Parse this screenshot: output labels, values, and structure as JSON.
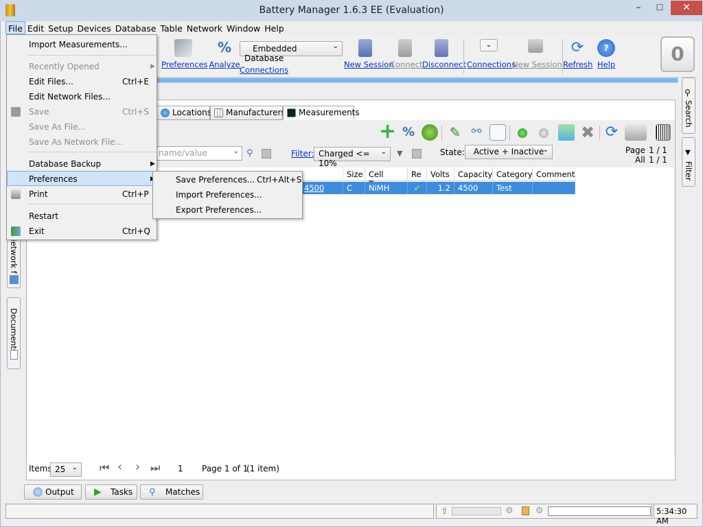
{
  "window": {
    "title": "Battery Manager 1.6.3 EE (Evaluation)",
    "minimize": "–",
    "maximize": "☐",
    "close": "✕"
  },
  "menubar": [
    "File",
    "Edit",
    "Setup",
    "Devices",
    "Database",
    "Table",
    "Network",
    "Window",
    "Help"
  ],
  "toolbar": {
    "preferences": "Preferences",
    "analyze": "Analyze",
    "connections": "Connections",
    "database_select": "Embedded Database",
    "new_session": "New Session",
    "connect": "Connect",
    "disconnect": "Disconnect",
    "connections2": "Connections",
    "new_session2": "New Session",
    "refresh": "Refresh",
    "help": "Help",
    "counter": "0"
  },
  "tabs": [
    "Locations",
    "Manufacturers",
    "Measurements"
  ],
  "filter": {
    "search_placeholder": "name/value",
    "label": "Filter:",
    "value": "Charged <= 10%",
    "state_label": "State:",
    "state_value": "Active + Inactive"
  },
  "paging": {
    "page_label": "Page",
    "page_value": "1 / 1",
    "all_label": "All",
    "all_value": "1 / 1"
  },
  "table": {
    "columns": [
      "Size",
      "Cell Type",
      "Re",
      "Volts",
      "Capacity",
      "Category",
      "Comment"
    ],
    "row": {
      "capacity_link": "4500 mAh",
      "size": "C",
      "cell_type": "NiMH",
      "re": "✔",
      "volts": "1.2 V",
      "capacity": "4500 mAh",
      "category": "Test",
      "comment": ""
    }
  },
  "footer": {
    "items_label": "Items",
    "items_value": "25",
    "page_num": "1",
    "page_info": "Page 1 of 1",
    "count_info": "(1 item)"
  },
  "bottom_tabs": [
    "Output",
    "Tasks",
    "Matches"
  ],
  "side_tabs": {
    "left": [
      "Network f",
      "Documents"
    ],
    "right": [
      "Search",
      "Filter"
    ]
  },
  "status": {
    "time": "5:34:30 AM"
  },
  "file_menu": [
    {
      "label": "Import Measurements...",
      "shortcut": ""
    },
    {
      "label": "Recently Opened",
      "shortcut": ""
    },
    {
      "label": "Edit Files...",
      "shortcut": "Ctrl+E"
    },
    {
      "label": "Edit Network Files...",
      "shortcut": ""
    },
    {
      "label": "Save",
      "shortcut": "Ctrl+S"
    },
    {
      "label": "Save As File...",
      "shortcut": ""
    },
    {
      "label": "Save As Network File...",
      "shortcut": ""
    },
    {
      "label": "Database Backup",
      "shortcut": ""
    },
    {
      "label": "Preferences",
      "shortcut": ""
    },
    {
      "label": "Print",
      "shortcut": "Ctrl+P"
    },
    {
      "label": "Restart",
      "shortcut": ""
    },
    {
      "label": "Exit",
      "shortcut": "Ctrl+Q"
    }
  ],
  "pref_menu": [
    {
      "label": "Save Preferences...",
      "shortcut": "Ctrl+Alt+S"
    },
    {
      "label": "Import Preferences...",
      "shortcut": ""
    },
    {
      "label": "Export Preferences...",
      "shortcut": ""
    }
  ],
  "colors": {
    "selection": "#3f8cde",
    "link": "#0033cc",
    "menu_highlight": "#d1e3f7"
  }
}
